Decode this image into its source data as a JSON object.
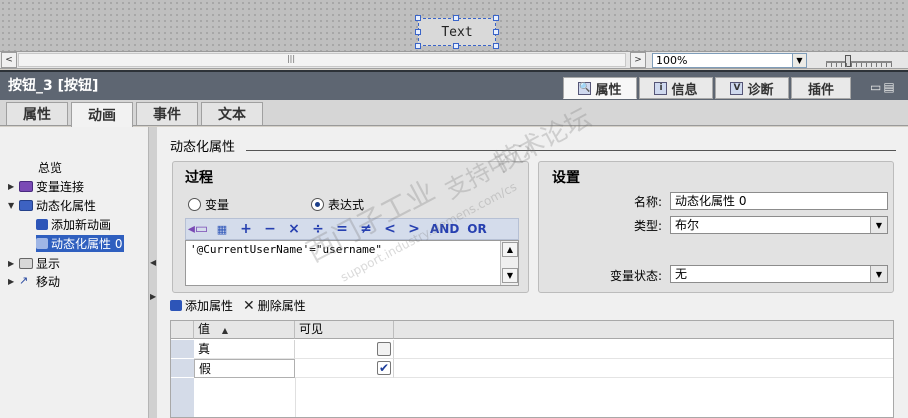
{
  "canvas": {
    "widget_text": "Text"
  },
  "scrollbar": {
    "left_arrow": "<",
    "right_arrow": ">",
    "thumb": "|||"
  },
  "zoom": {
    "value": "100%"
  },
  "inspector": {
    "title": "按钮_3 [按钮]",
    "top_tabs": [
      {
        "label": "属性",
        "icon": "properties-icon",
        "active": true
      },
      {
        "label": "信息",
        "icon": "info-icon",
        "active": false
      },
      {
        "label": "诊断",
        "icon": "diagnostics-icon",
        "active": false
      },
      {
        "label": "插件",
        "icon": "",
        "active": false
      }
    ],
    "sub_tabs": [
      {
        "label": "属性",
        "active": false
      },
      {
        "label": "动画",
        "active": true
      },
      {
        "label": "事件",
        "active": false
      },
      {
        "label": "文本",
        "active": false
      }
    ]
  },
  "tree": {
    "items": [
      {
        "label": "总览",
        "expand": ""
      },
      {
        "label": "变量连接",
        "expand": "▶"
      },
      {
        "label": "动态化属性",
        "expand": "▼"
      },
      {
        "label": "添加新动画",
        "expand": ""
      },
      {
        "label": "动态化属性 0",
        "expand": ""
      },
      {
        "label": "显示",
        "expand": "▶"
      },
      {
        "label": "移动",
        "expand": "▶"
      }
    ]
  },
  "main": {
    "section_title": "动态化属性",
    "process": {
      "title": "过程",
      "radio_variable": "变量",
      "radio_expression": "表达式",
      "selected": "expression",
      "toolbar": [
        "+",
        "−",
        "×",
        "÷",
        "=",
        "≠",
        "<",
        ">",
        "AND",
        "OR"
      ],
      "expression": "'@CurrentUserName'=\"username\""
    },
    "settings": {
      "title": "设置",
      "name_label": "名称:",
      "name_value": "动态化属性 0",
      "type_label": "类型:",
      "type_value": "布尔",
      "var_state_label": "变量状态:",
      "var_state_value": "无"
    },
    "attr_bar": {
      "add": "添加属性",
      "delete": "删除属性"
    },
    "table": {
      "headers": [
        "值",
        "可见"
      ],
      "sort_indicator": "▲",
      "rows": [
        {
          "value": "真",
          "visible": false
        },
        {
          "value": "假",
          "visible": true
        }
      ]
    }
  },
  "watermarks": [
    "西门子工业",
    "支持中心",
    "技术论坛",
    "support.industry.siemens.com/cs"
  ]
}
